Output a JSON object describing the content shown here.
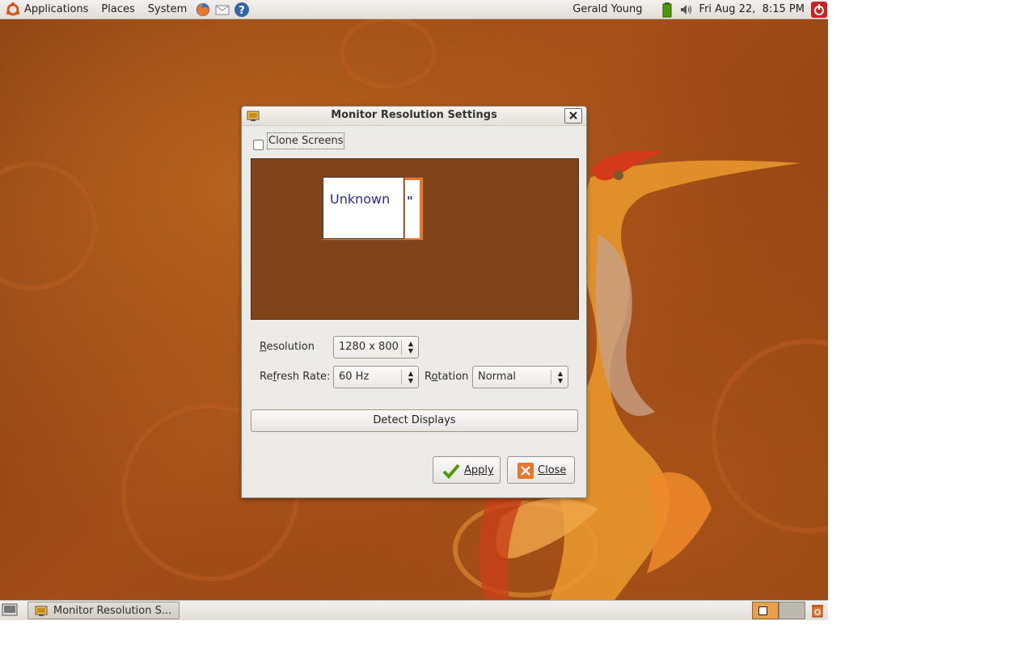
{
  "top_panel": {
    "menus": [
      "Applications",
      "Places",
      "System"
    ],
    "user": "Gerald Young",
    "clock": "Fri Aug 22,  8:15 PM",
    "icons": [
      "ubuntu-logo-icon",
      "firefox-icon",
      "mail-icon",
      "help-icon",
      "battery-icon",
      "volume-icon",
      "power-icon"
    ]
  },
  "dialog": {
    "title": "Monitor Resolution Settings",
    "clone_screens_label": "Clone Screens",
    "clone_screens_checked": false,
    "monitor_label": "Unknown",
    "monitor_behind_label": "\"",
    "resolution_label": "Resolution",
    "resolution_value": "1280 x 800",
    "refresh_rate_label": "Refresh Rate:",
    "refresh_rate_value": "60 Hz",
    "rotation_label": "Rotation",
    "rotation_value": "Normal",
    "detect_displays_label": "Detect Displays",
    "apply_label": "Apply",
    "close_label": "Close"
  },
  "bottom_panel": {
    "task_label": "Monitor Resolution S..."
  },
  "colors": {
    "monitor_area_bg": "#80431a",
    "monitor_text": "#2b2b8c",
    "accent_orange": "#e8762c"
  }
}
